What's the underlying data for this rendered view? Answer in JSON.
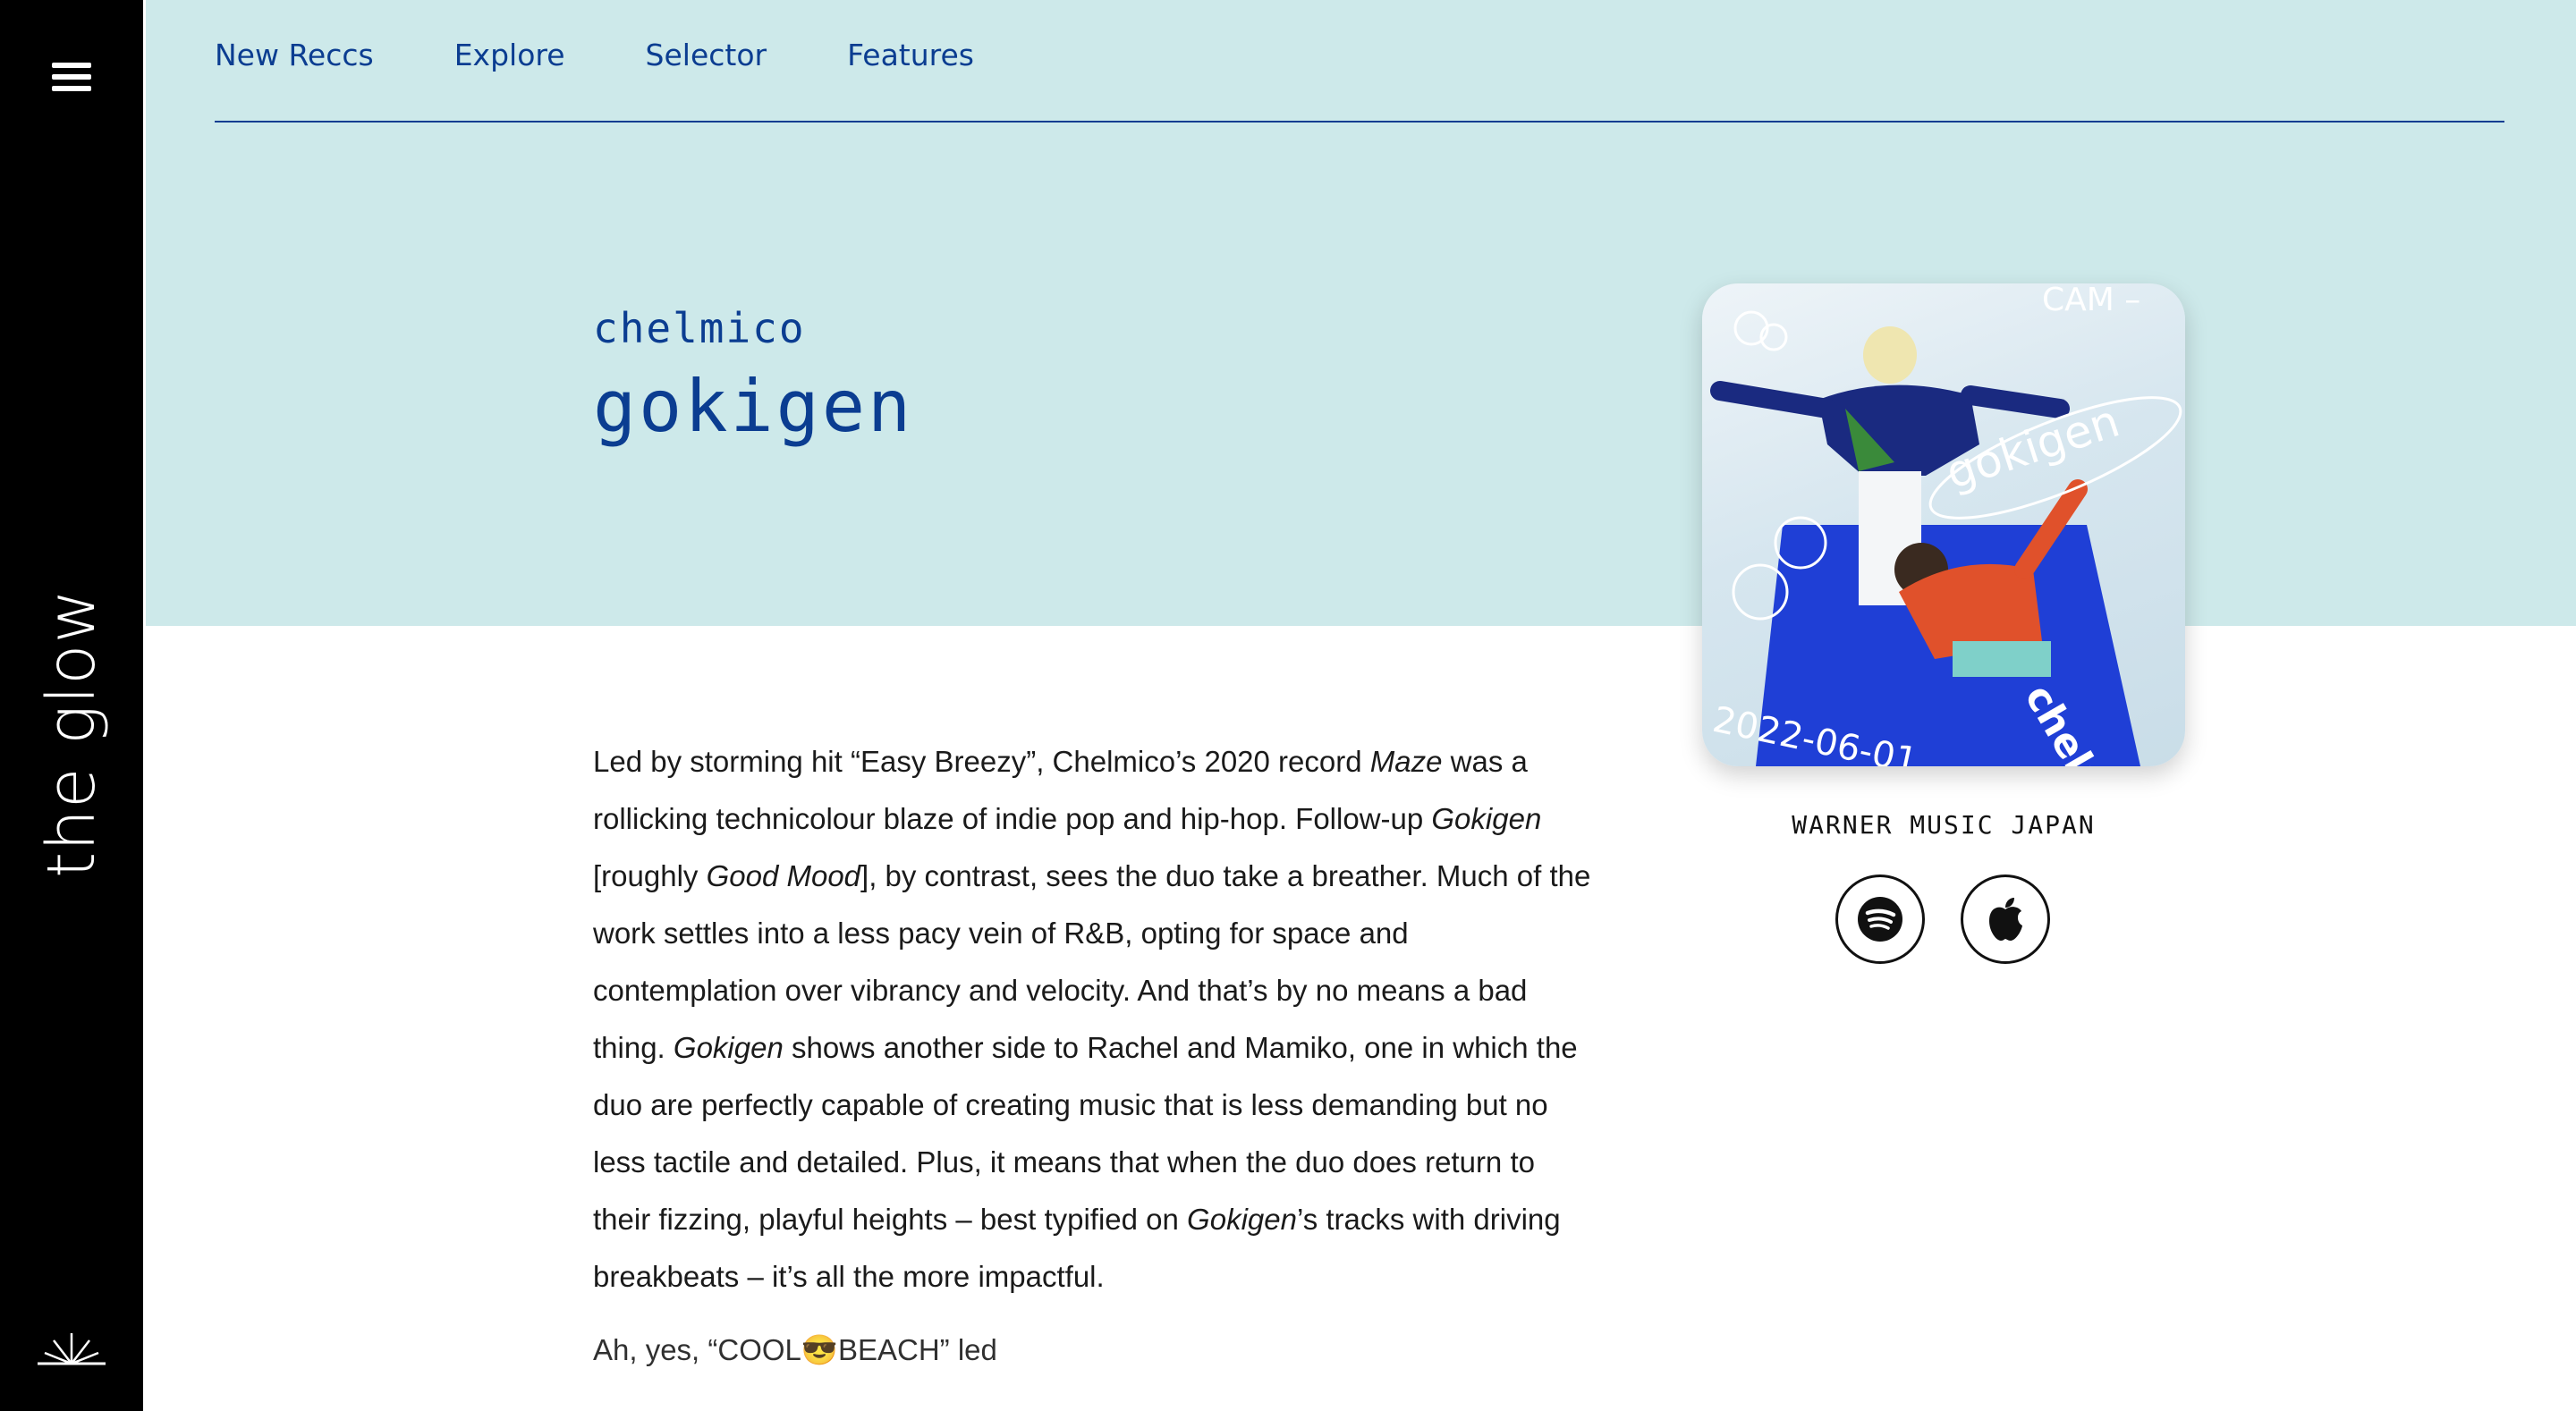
{
  "sidebar": {
    "brand": "the glow",
    "menu_icon": "hamburger-icon",
    "bottom_icon": "sunrise-icon"
  },
  "nav": {
    "items": [
      "New Reccs",
      "Explore",
      "Selector",
      "Features"
    ]
  },
  "hero": {
    "artist": "chelmico",
    "album": "gokigen"
  },
  "cover": {
    "corner_text": "CAM –",
    "title_text": "gokigen",
    "date_text": "2022-06-01",
    "logo_text": "chelmi"
  },
  "release": {
    "label": "WARNER MUSIC JAPAN",
    "spotify_icon": "spotify-icon",
    "apple_icon": "apple-icon"
  },
  "review": {
    "p1_a": "Led by storming hit “Easy Breezy”, Chelmico’s 2020 record ",
    "p1_maze": "Maze",
    "p1_b": " was a rollicking technicolour blaze of indie pop and hip-hop. Follow-up ",
    "p1_gokigen1": "Gokigen",
    "p1_c": " [roughly ",
    "p1_goodmood": "Good Mood",
    "p1_d": "], by contrast, sees the duo take a breather. Much of the work settles into a less pacy vein of R&B, opting for space and contemplation over vibrancy and velocity. And that’s by no means a bad thing. ",
    "p1_gokigen2": "Gokigen",
    "p1_e": " shows another side to Rachel and Mamiko, one in which the duo are perfectly capable of creating music that is less demanding but no less tactile and detailed. Plus, it means that when the duo does return to their fizzing, playful heights – best typified on ",
    "p1_gokigen3": "Gokigen",
    "p1_f": "’s tracks with driving breakbeats – it’s all the more impactful.",
    "p2_partial": "Ah, yes, “COOL😎BEACH” led"
  },
  "colors": {
    "navy": "#0b3d91",
    "hero_bg": "#cde9ea",
    "sidebar_bg": "#000000"
  }
}
